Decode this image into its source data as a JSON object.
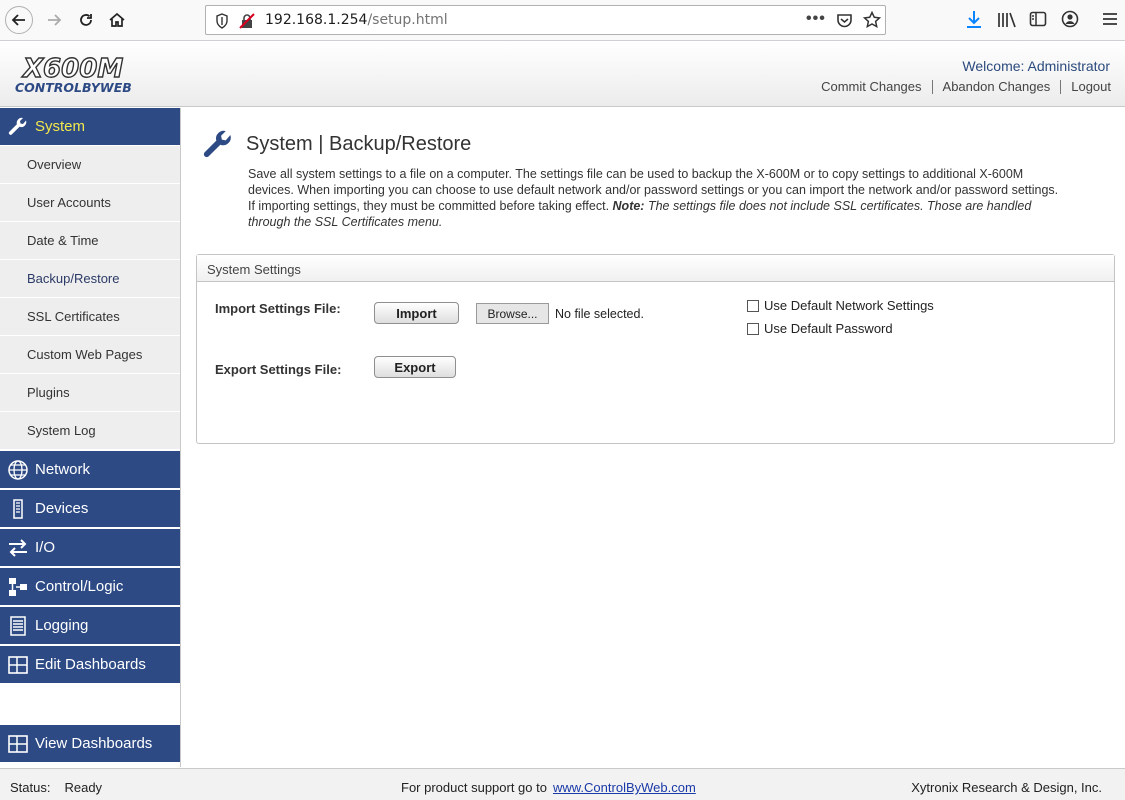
{
  "browser": {
    "url_host": "192.168.1.254",
    "url_path": "/setup.html",
    "menu_dots": "•••"
  },
  "header": {
    "logo_model": "X600M",
    "logo_brand": "CONTROLBYWEB",
    "welcome": "Welcome: Administrator",
    "links": [
      "Commit Changes",
      "Abandon Changes",
      "Logout"
    ]
  },
  "sidebar": {
    "main_items": [
      {
        "label": "System",
        "icon": "wrench-icon"
      },
      {
        "label": "Network",
        "icon": "globe-icon"
      },
      {
        "label": "Devices",
        "icon": "device-icon"
      },
      {
        "label": "I/O",
        "icon": "arrows-icon"
      },
      {
        "label": "Control/Logic",
        "icon": "flowchart-icon"
      },
      {
        "label": "Logging",
        "icon": "log-icon"
      },
      {
        "label": "Edit Dashboards",
        "icon": "dashboard-icon"
      },
      {
        "label": "View Dashboards",
        "icon": "dashboard-icon"
      }
    ],
    "sub_items": [
      "Overview",
      "User Accounts",
      "Date & Time",
      "Backup/Restore",
      "SSL Certificates",
      "Custom Web Pages",
      "Plugins",
      "System Log"
    ],
    "active_main": "System",
    "active_sub": "Backup/Restore"
  },
  "main": {
    "title": "System | Backup/Restore",
    "desc_text": "Save all system settings to a file on a computer. The settings file can be used to backup the X-600M or to copy settings to additional X-600M devices. When importing you can choose to use default network and/or password settings or you can import the network and/or password settings. If importing settings, they must be committed before taking effect. ",
    "desc_note_label": "Note:",
    "desc_note_text": " The settings file does not include SSL certificates. Those are handled through the SSL Certificates menu.",
    "panel_title": "System Settings",
    "import_label": "Import Settings File:",
    "import_button": "Import",
    "browse_button": "Browse...",
    "file_status": "No file selected.",
    "export_label": "Export Settings File:",
    "export_button": "Export",
    "checkboxes": [
      {
        "label": "Use Default Network Settings",
        "checked": false
      },
      {
        "label": "Use Default Password",
        "checked": false
      }
    ]
  },
  "status_bar": {
    "status_label": "Status:",
    "status_value": "Ready",
    "support_text": "For product support go to",
    "support_link": "www.ControlByWeb.com",
    "company": "Xytronix Research & Design, Inc."
  },
  "colors": {
    "nav_blue": "#2d4a85",
    "active_yellow": "#f2e84b",
    "submenu_gray": "#eeeeee"
  }
}
